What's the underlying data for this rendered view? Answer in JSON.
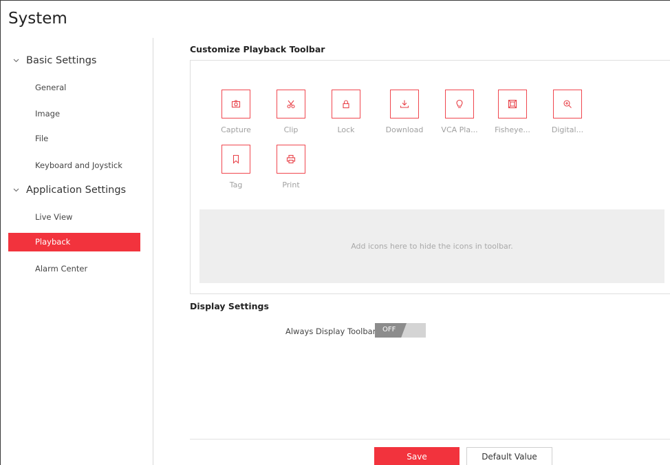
{
  "app": {
    "title": "System"
  },
  "sidebar": {
    "groups": [
      {
        "label": "Basic Settings",
        "icon": "chevron-down-icon",
        "items": [
          {
            "label": "General"
          },
          {
            "label": "Image"
          },
          {
            "label": "File"
          },
          {
            "label": "Keyboard and Joystick"
          }
        ]
      },
      {
        "label": "Application Settings",
        "icon": "chevron-down-icon",
        "items": [
          {
            "label": "Live View"
          },
          {
            "label": "Playback",
            "active": true
          },
          {
            "label": "Alarm Center"
          }
        ]
      }
    ]
  },
  "main": {
    "toolbar_section": {
      "title": "Customize Playback Toolbar",
      "tools": [
        {
          "label": "Capture",
          "icon": "camera-icon"
        },
        {
          "label": "Clip",
          "icon": "scissors-icon"
        },
        {
          "label": "Lock",
          "icon": "lock-icon"
        },
        {
          "label": "Download",
          "icon": "download-icon"
        },
        {
          "label": "VCA Pla...",
          "icon": "lightbulb-icon"
        },
        {
          "label": "Fisheye...",
          "icon": "fisheye-icon"
        },
        {
          "label": "Digital...",
          "icon": "zoom-in-icon"
        },
        {
          "label": "Tag",
          "icon": "bookmark-icon"
        },
        {
          "label": "Print",
          "icon": "printer-icon"
        }
      ],
      "hidden_area_text": "Add icons here to hide the icons in toolbar."
    },
    "display_section": {
      "title": "Display Settings",
      "always_display_toolbar": {
        "label": "Always Display Toolbar",
        "state": "OFF"
      }
    }
  },
  "footer": {
    "save_label": "Save",
    "default_label": "Default Value"
  },
  "colors": {
    "accent": "#f2333d",
    "icon_border": "#f0454d",
    "toggle_off": "#8c8c8c"
  }
}
